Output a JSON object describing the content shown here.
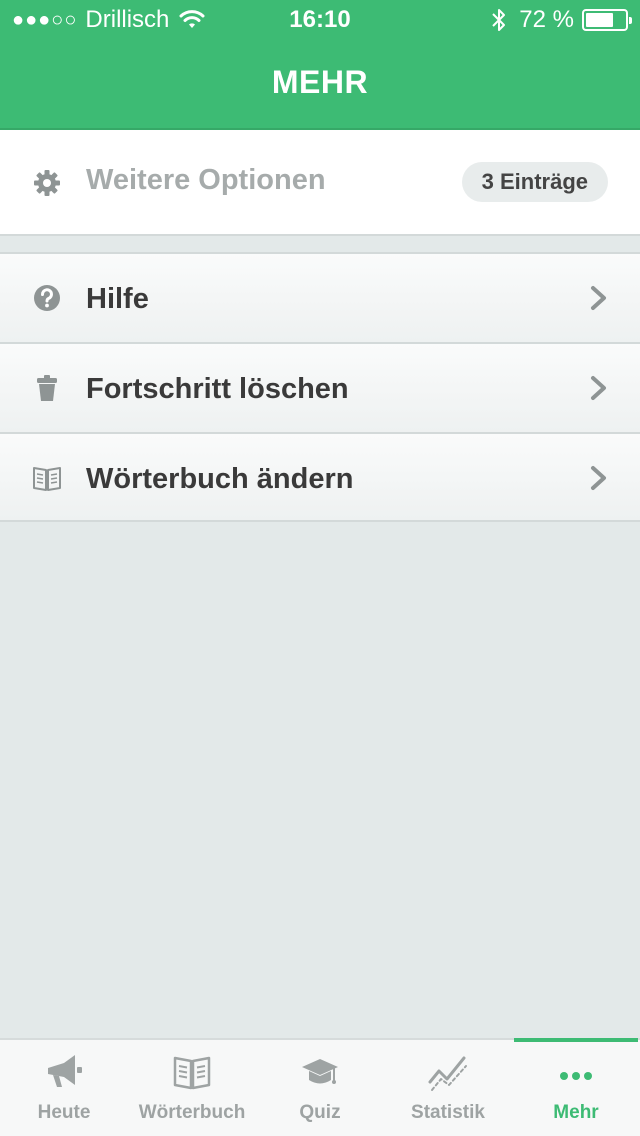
{
  "status_bar": {
    "signal_dots": "●●●○○",
    "carrier": "Drillisch",
    "time": "16:10",
    "battery_text": "72 %",
    "battery_level": 0.72
  },
  "header": {
    "title": "MEHR"
  },
  "options": {
    "icon": "gear-icon",
    "label": "Weitere Optionen",
    "badge": "3 Einträge"
  },
  "menu": {
    "items": [
      {
        "icon": "help-icon",
        "label": "Hilfe"
      },
      {
        "icon": "trash-icon",
        "label": "Fortschritt löschen"
      },
      {
        "icon": "book-icon",
        "label": "Wörterbuch ändern"
      }
    ]
  },
  "tabbar": {
    "active": "Mehr",
    "tabs": [
      {
        "icon": "megaphone-icon",
        "label": "Heute"
      },
      {
        "icon": "book-icon",
        "label": "Wörterbuch"
      },
      {
        "icon": "graduation-cap-icon",
        "label": "Quiz"
      },
      {
        "icon": "chart-line-icon",
        "label": "Statistik"
      },
      {
        "icon": "more-dots-icon",
        "label": "Mehr"
      }
    ]
  },
  "colors": {
    "accent": "#3dbb74",
    "background": "#e3e9e9",
    "icon_gray": "#9ea3a3"
  }
}
